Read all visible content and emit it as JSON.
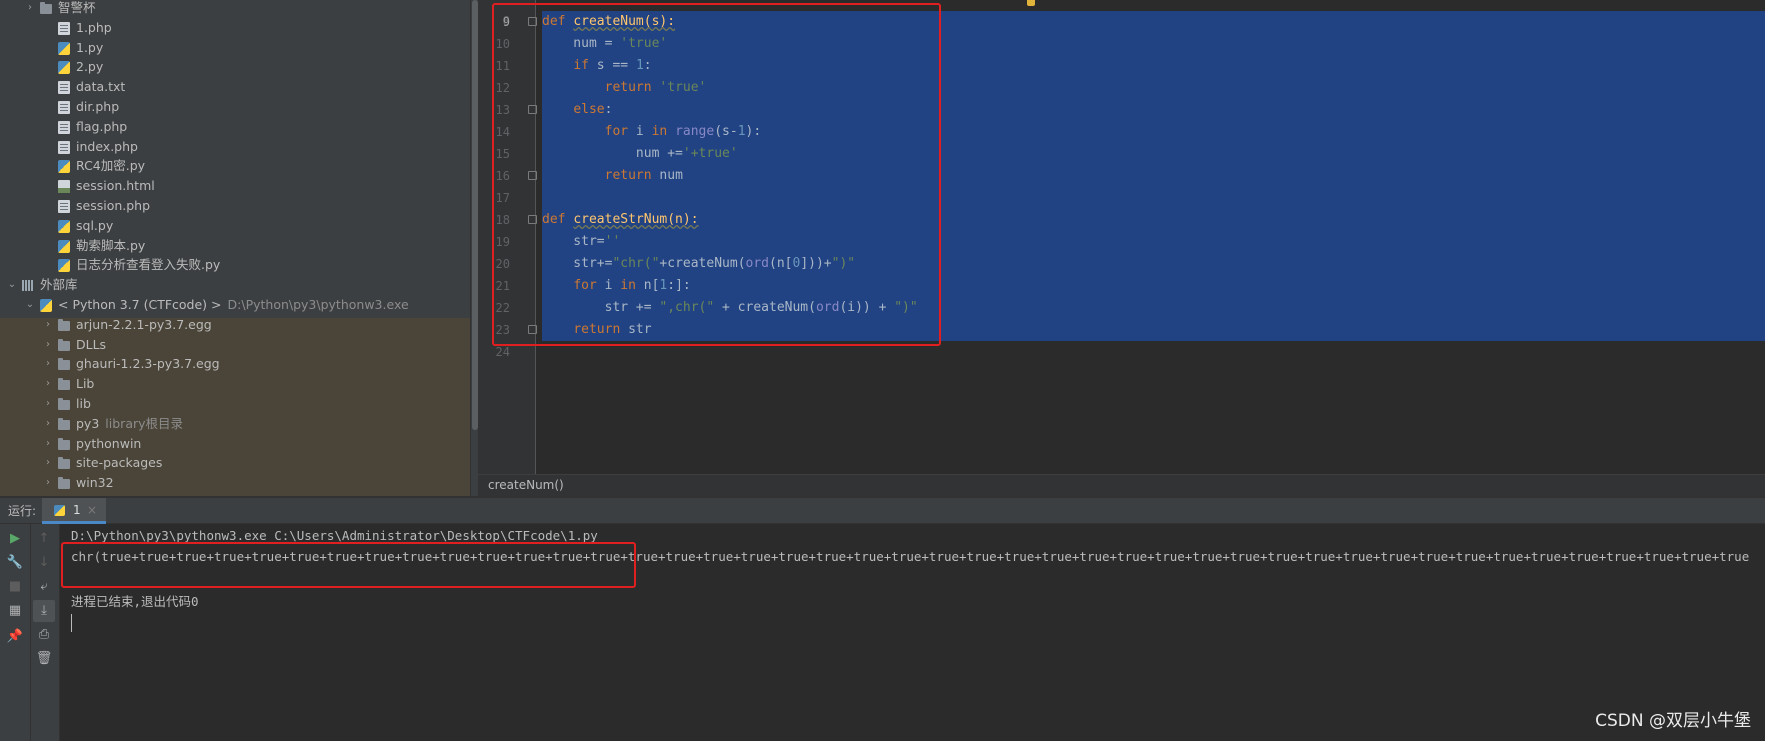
{
  "project_tree": {
    "items": [
      {
        "label": "智警杯",
        "type": "folder",
        "indent": 1,
        "arrow": "›",
        "hint": ""
      },
      {
        "label": "1.php",
        "type": "file",
        "indent": 2,
        "arrow": "",
        "hint": ""
      },
      {
        "label": "1.py",
        "type": "py",
        "indent": 2,
        "arrow": "",
        "hint": ""
      },
      {
        "label": "2.py",
        "type": "py",
        "indent": 2,
        "arrow": "",
        "hint": ""
      },
      {
        "label": "data.txt",
        "type": "file",
        "indent": 2,
        "arrow": "",
        "hint": ""
      },
      {
        "label": "dir.php",
        "type": "file",
        "indent": 2,
        "arrow": "",
        "hint": ""
      },
      {
        "label": "flag.php",
        "type": "file",
        "indent": 2,
        "arrow": "",
        "hint": ""
      },
      {
        "label": "index.php",
        "type": "file",
        "indent": 2,
        "arrow": "",
        "hint": ""
      },
      {
        "label": "RC4加密.py",
        "type": "py",
        "indent": 2,
        "arrow": "",
        "hint": ""
      },
      {
        "label": "session.html",
        "type": "html",
        "indent": 2,
        "arrow": "",
        "hint": ""
      },
      {
        "label": "session.php",
        "type": "file",
        "indent": 2,
        "arrow": "",
        "hint": ""
      },
      {
        "label": "sql.py",
        "type": "py",
        "indent": 2,
        "arrow": "",
        "hint": ""
      },
      {
        "label": "勒索脚本.py",
        "type": "py",
        "indent": 2,
        "arrow": "",
        "hint": ""
      },
      {
        "label": "日志分析查看登入失败.py",
        "type": "py",
        "indent": 2,
        "arrow": "",
        "hint": ""
      },
      {
        "label": "外部库",
        "type": "lib",
        "indent": 0,
        "arrow": "⌄",
        "hint": ""
      },
      {
        "label": "< Python 3.7 (CTFcode) >",
        "type": "py",
        "indent": 1,
        "arrow": "⌄",
        "hint": "D:\\Python\\py3\\pythonw3.exe"
      },
      {
        "label": "arjun-2.2.1-py3.7.egg",
        "type": "folder",
        "indent": 2,
        "arrow": "›",
        "hint": ""
      },
      {
        "label": "DLLs",
        "type": "folder",
        "indent": 2,
        "arrow": "›",
        "hint": ""
      },
      {
        "label": "ghauri-1.2.3-py3.7.egg",
        "type": "folder",
        "indent": 2,
        "arrow": "›",
        "hint": ""
      },
      {
        "label": "Lib",
        "type": "folder",
        "indent": 2,
        "arrow": "›",
        "hint": ""
      },
      {
        "label": "lib",
        "type": "folder",
        "indent": 2,
        "arrow": "›",
        "hint": ""
      },
      {
        "label": "py3",
        "type": "folder",
        "indent": 2,
        "arrow": "›",
        "hint": "library根目录"
      },
      {
        "label": "pythonwin",
        "type": "folder",
        "indent": 2,
        "arrow": "›",
        "hint": ""
      },
      {
        "label": "site-packages",
        "type": "folder",
        "indent": 2,
        "arrow": "›",
        "hint": ""
      },
      {
        "label": "win32",
        "type": "folder",
        "indent": 2,
        "arrow": "›",
        "hint": ""
      }
    ]
  },
  "editor": {
    "top_partial_line": "8",
    "current_line": "9",
    "lines": [
      {
        "n": "9",
        "sel": true,
        "fold": true,
        "html": "<span class=\"kw\">def</span> <span class=\"fn\">createNum(s):</span>"
      },
      {
        "n": "10",
        "sel": true,
        "fold": false,
        "html": "    num = <span class=\"str\">'true'</span>"
      },
      {
        "n": "11",
        "sel": true,
        "fold": false,
        "html": "    <span class=\"kw\">if</span> s == <span class=\"num\">1</span>:"
      },
      {
        "n": "12",
        "sel": true,
        "fold": false,
        "html": "        <span class=\"kw\">return</span> <span class=\"str\">'true'</span>"
      },
      {
        "n": "13",
        "sel": true,
        "fold": true,
        "html": "    <span class=\"kw\">else</span>:"
      },
      {
        "n": "14",
        "sel": true,
        "fold": false,
        "html": "        <span class=\"kw\">for</span> i <span class=\"kw\">in</span> <span class=\"bi\">range</span>(s-<span class=\"num\">1</span>):"
      },
      {
        "n": "15",
        "sel": true,
        "fold": false,
        "html": "            num +=<span class=\"str\">'+true'</span>"
      },
      {
        "n": "16",
        "sel": true,
        "fold": true,
        "html": "        <span class=\"kw\">return</span> num"
      },
      {
        "n": "17",
        "sel": true,
        "fold": false,
        "html": ""
      },
      {
        "n": "18",
        "sel": true,
        "fold": true,
        "html": "<span class=\"kw\">def</span> <span class=\"fn\">createStrNum(n):</span>"
      },
      {
        "n": "19",
        "sel": true,
        "fold": false,
        "html": "    str=<span class=\"str\">''</span>"
      },
      {
        "n": "20",
        "sel": true,
        "fold": false,
        "html": "    str+=<span class=\"str\">\"chr(\"</span>+createNum(<span class=\"bi\">ord</span>(n[<span class=\"num\">0</span>]))+<span class=\"str\">\")\"</span>"
      },
      {
        "n": "21",
        "sel": true,
        "fold": false,
        "html": "    <span class=\"kw\">for</span> i <span class=\"kw\">in</span> n[<span class=\"num\">1</span>:]:"
      },
      {
        "n": "22",
        "sel": true,
        "fold": false,
        "html": "        str += <span class=\"str\">\",chr(\"</span> + createNum(<span class=\"bi\">ord</span>(i)) + <span class=\"str\">\")\"</span>"
      },
      {
        "n": "23",
        "sel": true,
        "fold": true,
        "html": "    <span class=\"kw\">return</span> str"
      },
      {
        "n": "24",
        "sel": false,
        "fold": false,
        "html": ""
      }
    ]
  },
  "breadcrumb": {
    "text": "createNum()"
  },
  "run": {
    "label": "运行:",
    "tab_name": "1",
    "tab_close": "×",
    "console": {
      "command": "D:\\Python\\py3\\pythonw3.exe C:\\Users\\Administrator\\Desktop\\CTFcode\\1.py",
      "output": "chr(true+true+true+true+true+true+true+true+true+true+true+true+true+true+true+true+true+true+true+true+true+true+true+true+true+true+true+true+true+true+true+true+true+true+true+true+true+true+true+true+true+true+true+true",
      "exit": "进程已结束,退出代码0"
    }
  },
  "icons": {
    "run": "play-icon",
    "settings": "wrench-icon",
    "stop": "stop-icon",
    "layout": "layout-icon",
    "pin": "pin-icon",
    "up": "up-arrow-icon",
    "down": "down-arrow-icon",
    "wrap": "soft-wrap-icon",
    "scroll_end": "scroll-to-end-icon",
    "print": "print-icon",
    "trash": "trash-icon"
  },
  "colors": {
    "selection": "#214283",
    "annotation_box": "#e02020",
    "tab_underline": "#4a88c7"
  },
  "watermark": "CSDN @双层小牛堡"
}
